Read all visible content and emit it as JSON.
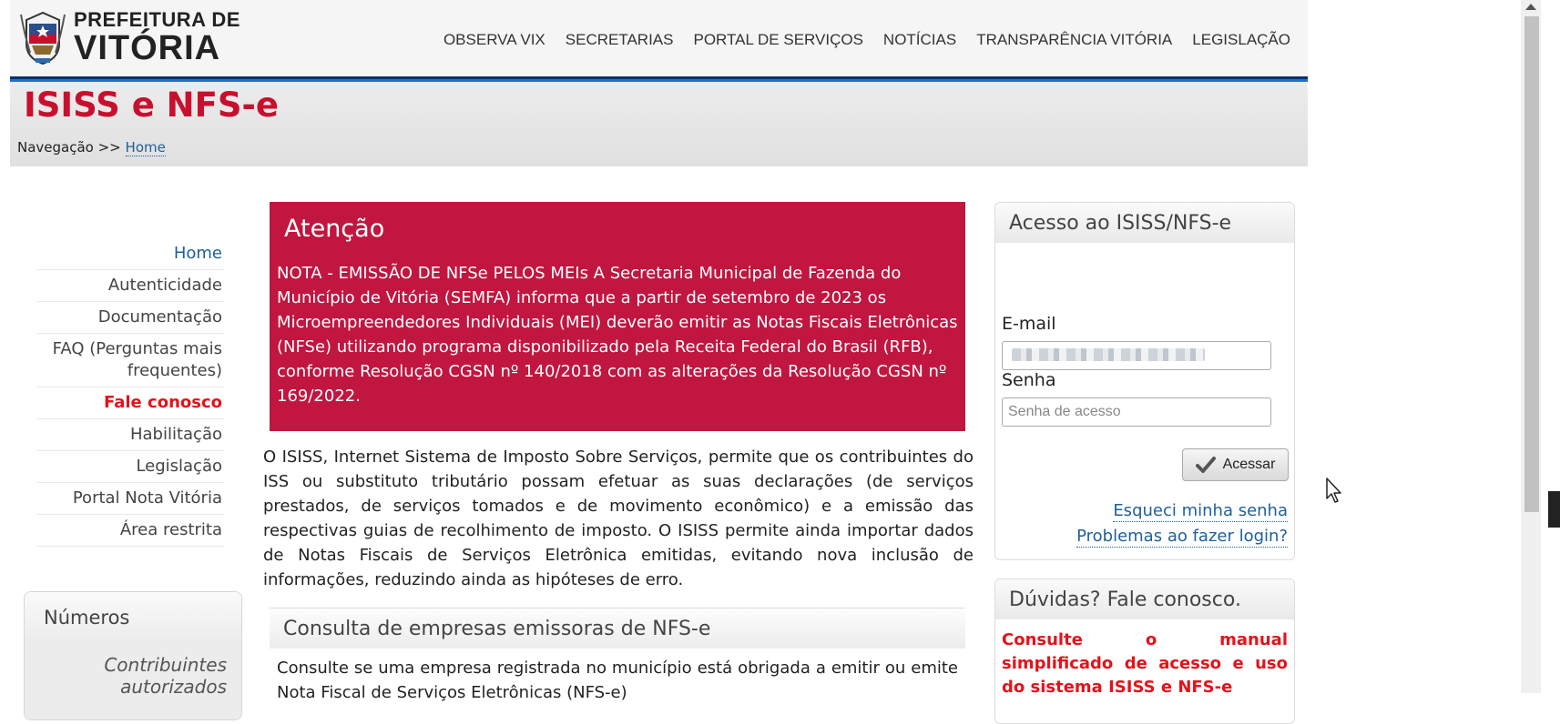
{
  "header": {
    "logo_line1": "PREFEITURA DE",
    "logo_line2": "VITÓRIA",
    "nav": [
      "OBSERVA VIX",
      "SECRETARIAS",
      "PORTAL DE SERVIÇOS",
      "NOTÍCIAS",
      "TRANSPARÊNCIA VITÓRIA",
      "LEGISLAÇÃO"
    ]
  },
  "banner": {
    "title": "ISISS e NFS-e",
    "breadcrumb_label": "Navegação >>",
    "breadcrumb_link": "Home"
  },
  "sidebar": {
    "items": [
      {
        "label": "Home"
      },
      {
        "label": "Autenticidade"
      },
      {
        "label": "Documentação"
      },
      {
        "label": "FAQ (Perguntas mais frequentes)"
      },
      {
        "label": "Fale conosco"
      },
      {
        "label": "Habilitação"
      },
      {
        "label": "Legislação"
      },
      {
        "label": "Portal Nota Vitória"
      },
      {
        "label": "Área restrita"
      }
    ],
    "numbers_title": "Números",
    "numbers_text": "Contribuintes autorizados"
  },
  "main": {
    "alert_title": "Atenção",
    "alert_text": "NOTA - EMISSÃO DE NFSe PELOS MEIs A Secretaria Municipal de Fazenda do Município de Vitória (SEMFA) informa que a partir de setembro de 2023 os Microempreendedores Individuais (MEI) deverão emitir as Notas Fiscais Eletrônicas (NFSe) utilizando programa disponibilizado pela Receita Federal do Brasil (RFB), conforme Resolução CGSN nº 140/2018 com as alterações da Resolução CGSN nº 169/2022.",
    "intro": "O ISISS, Internet Sistema de Imposto Sobre Serviços, permite que os contribuintes do ISS ou substituto tributário possam efetuar as suas declarações (de serviços prestados, de serviços tomados e de movimento econômico) e a emissão das respectivas guias de recolhimento de imposto. O ISISS permite ainda importar dados de Notas Fiscais de Serviços Eletrônica emitidas, evitando nova inclusão de informações, reduzindo ainda as hipóteses de erro.",
    "panel2_title": "Consulta de empresas emissoras de NFS-e",
    "panel2_text": "Consulte se uma empresa registrada no município está obrigada a emitir ou emite Nota Fiscal de Serviços Eletrônicas (NFS-e)"
  },
  "login": {
    "title": "Acesso ao ISISS/NFS-e",
    "email_label": "E-mail",
    "password_label": "Senha",
    "password_placeholder": "Senha de acesso",
    "submit_label": "Acessar",
    "forgot_link": "Esqueci minha senha",
    "problems_link": "Problemas ao fazer login?"
  },
  "help": {
    "title": "Dúvidas? Fale conosco.",
    "link": "Consulte o manual simplificado de acesso e uso do sistema ISISS e NFS-e"
  },
  "colors": {
    "brand_red": "#c8102e",
    "alert_bg": "#c0163f",
    "link_blue": "#1f5f99",
    "navy_bar": "#0a2f6b"
  }
}
